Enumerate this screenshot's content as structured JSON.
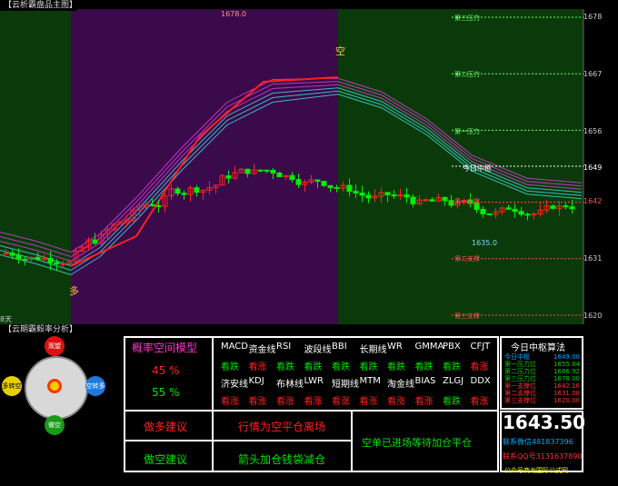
{
  "app": {
    "main_panel_title": "【云析霸盘品主图】",
    "sub_panel_title": "【云期霸毅率分析】"
  },
  "chart": {
    "price_axis": [
      "1678",
      "1667",
      "1656",
      "1649",
      "1642",
      "1631",
      "1620"
    ],
    "high_label": "1678.0",
    "low_label": "1635.0",
    "signal_long": "多",
    "signal_short": "空",
    "pivot_label": "今日中枢",
    "resist_labels": [
      "第三压力",
      "第二压力",
      "第一压力"
    ],
    "support_labels": [
      "第一支撑",
      "第二支撑",
      "第三支撑"
    ],
    "left_bottom_label": "8天",
    "colors": {
      "up": "#ff2020",
      "down": "#00ee00",
      "zone_up": "#3a0a4a",
      "zone_down": "#0a3a0a"
    }
  },
  "gauge": {
    "top": "观望",
    "left": "多转空",
    "right": "空转多",
    "bottom": "做空"
  },
  "model": {
    "title": "概率空间模型",
    "pct_up": "45 %",
    "pct_down": "55 %",
    "indicators_row1": [
      "MACD",
      "资金线",
      "RSI",
      "波段线",
      "BBI",
      "长期线",
      "WR",
      "GMMA",
      "PBX",
      "CFJT"
    ],
    "states_row1": [
      "看跌",
      "看涨",
      "看跌",
      "看跌",
      "看跌",
      "看跌",
      "看跌",
      "看跌",
      "看跌",
      "看涨"
    ],
    "indicators_row2": [
      "济安线",
      "KDJ",
      "布林线",
      "LWR",
      "短期线",
      "MTM",
      "淘金线",
      "BIAS",
      "ZLGJ",
      "DDX"
    ],
    "states_row2": [
      "看涨",
      "看涨",
      "看涨",
      "看涨",
      "看涨",
      "看涨",
      "看涨",
      "看涨",
      "看跌",
      "看涨"
    ]
  },
  "advice": {
    "long_label": "做多建议",
    "long_text": "行情为空平仓离场",
    "short_label": "做空建议",
    "short_text": "箭头加仓钱袋减仓",
    "status_text": "空单已进场等待加仓平仓"
  },
  "pivot_calc": {
    "title": "今日中枢算法",
    "rows": [
      {
        "label": "今日中枢",
        "value": "1649.00",
        "color": "#00aaff"
      },
      {
        "label": "第一压力位",
        "value": "1655.84",
        "color": "#00cc00"
      },
      {
        "label": "第二压力位",
        "value": "1666.92",
        "color": "#00cc00"
      },
      {
        "label": "第三压力位",
        "value": "1678.00",
        "color": "#00cc00"
      },
      {
        "label": "第一支撑位",
        "value": "1642.16",
        "color": "#ff3030"
      },
      {
        "label": "第二支撑位",
        "value": "1631.08",
        "color": "#ff3030"
      },
      {
        "label": "第三支撑位",
        "value": "1620.00",
        "color": "#ff3030"
      }
    ],
    "price": "1643.50",
    "contact1": "联系微信481837396",
    "contact2": "联系QQ号3131637890",
    "footer": "公众号商龙国际公式网"
  }
}
